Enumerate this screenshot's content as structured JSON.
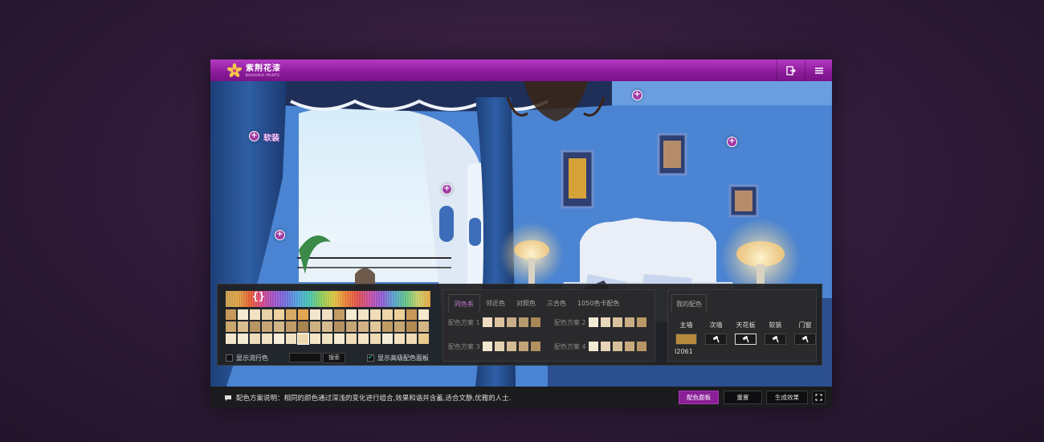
{
  "header": {
    "logo_cn": "紫荆花漆",
    "logo_en": "BAUHINIA PAINTS",
    "exit_icon": "exit-icon",
    "menu_icon": "menu-icon"
  },
  "scene": {
    "hotspot_label": "软装"
  },
  "palette": {
    "braces": "{}",
    "show_trend_label": "显示流行色",
    "search_button": "搜索",
    "show_advanced_label": "显示高级配色面板",
    "grid_colors": [
      "#c8995a",
      "#f5ead2",
      "#f3e3c4",
      "#e8d3a8",
      "#efd2a2",
      "#d9aa63",
      "#e3a64e",
      "#f2e6cf",
      "#efe0c4",
      "#c49b62",
      "#f6ecd3",
      "#f2e4c5",
      "#f1deb8",
      "#efd6a8",
      "#edd09a",
      "#c99758",
      "#f4e8cd",
      "#caa66c",
      "#d8bd8e",
      "#b89562",
      "#c6a676",
      "#d2b688",
      "#bf9c68",
      "#a8844f",
      "#cdb080",
      "#d6bb8e",
      "#b49060",
      "#c5a574",
      "#d0b284",
      "#e0c698",
      "#bf9a62",
      "#c8a672",
      "#b28a52",
      "#d4b482",
      "#f3e6cb",
      "#f5ebd4",
      "#efdcbb",
      "#f2e2c4",
      "#f6eed9",
      "#f0e0c0",
      "#eed8b0",
      "#f4e6c8",
      "#f1e2c2",
      "#f5e9d0",
      "#f0dcb8",
      "#f3e4c6",
      "#eddab2",
      "#f6ecd6",
      "#f2e0be",
      "#efdab4",
      "#e8c98e"
    ],
    "selected_index": 40
  },
  "schemes": {
    "tabs": [
      "同色系",
      "邻近色",
      "对照色",
      "三合色",
      "1050色卡配色"
    ],
    "active_tab": 0,
    "items": [
      {
        "name": "配色方案 1",
        "colors": [
          "#eedcc0",
          "#dcc3a0",
          "#c9ad86",
          "#b8996f",
          "#a88658"
        ]
      },
      {
        "name": "配色方案 2",
        "colors": [
          "#f5ead6",
          "#e8d8ba",
          "#d9c39e",
          "#c9ad84",
          "#ba9868"
        ]
      },
      {
        "name": "配色方案 3",
        "colors": [
          "#f2e6d0",
          "#e4d2b2",
          "#d3bb94",
          "#c2a478",
          "#b18f5e"
        ]
      },
      {
        "name": "配色方案 4",
        "colors": [
          "#f4e9d3",
          "#e6d5b6",
          "#d7c099",
          "#c8aa7e",
          "#b99564"
        ]
      }
    ]
  },
  "mine": {
    "tab": "我的配色",
    "parts": [
      {
        "label": "主墙",
        "color": "#b88a3e"
      },
      {
        "label": "次墙",
        "icon": "paint-roller-icon"
      },
      {
        "label": "天花板",
        "icon": "paint-roller-icon",
        "active": true
      },
      {
        "label": "软装",
        "icon": "paint-roller-icon"
      },
      {
        "label": "门窗",
        "icon": "paint-roller-icon"
      }
    ],
    "code": "I2061"
  },
  "status": {
    "description": "配色方案说明：相同的颜色通过深浅的变化进行组合,效果和谐并含蓄,适合文静,优雅的人士.",
    "palette_button": "配色面板",
    "reset_button": "重置",
    "generate_button": "生成效果",
    "fullscreen_icon": "fullscreen-icon"
  }
}
